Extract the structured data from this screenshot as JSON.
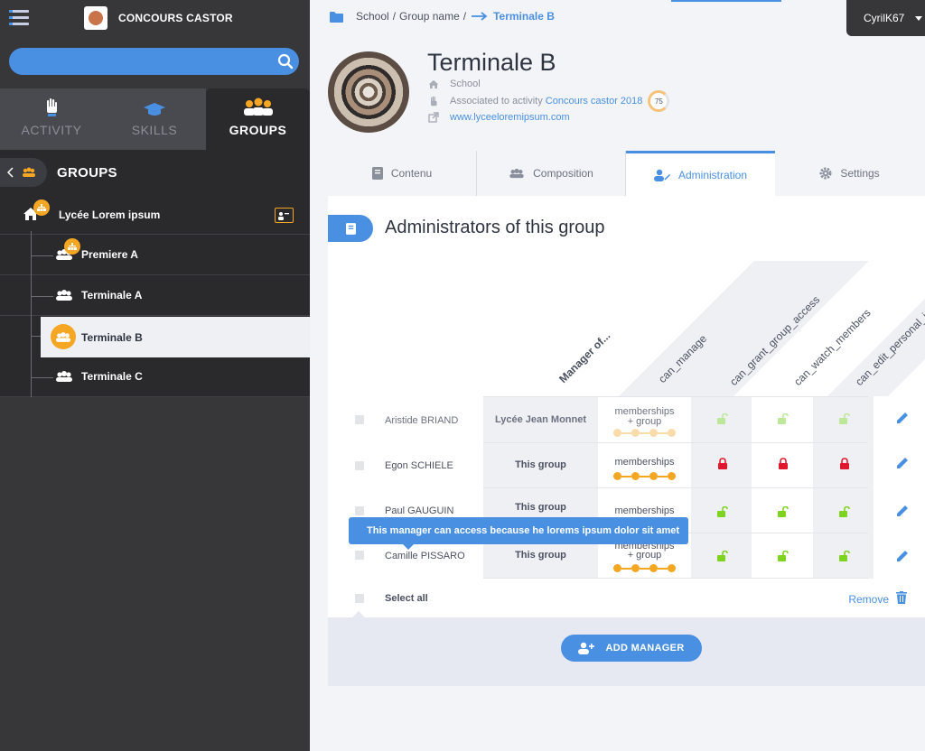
{
  "app": {
    "title": "CONCOURS CASTOR"
  },
  "search": {
    "placeholder": ""
  },
  "tabs": [
    {
      "label": "ACTIVITY",
      "icon": "hand-icon"
    },
    {
      "label": "SKILLS",
      "icon": "graduation-cap-icon"
    },
    {
      "label": "GROUPS",
      "icon": "group-icon"
    }
  ],
  "groups_panel": {
    "title": "GROUPS"
  },
  "tree": {
    "root": "Lycée Lorem ipsum",
    "children": [
      "Premiere A",
      "Terminale A",
      "Terminale B",
      "Terminale C"
    ]
  },
  "breadcrumb": {
    "part1": "School",
    "sep": "/",
    "part2": "Group name",
    "sep2": "/",
    "current": "Terminale B"
  },
  "user": {
    "name": "CyrilK67"
  },
  "group": {
    "name": "Terminale B",
    "type": "School",
    "activity_prefix": "Associated to activity",
    "activity_link": "Concours castor 2018",
    "score": "75",
    "website": "www.lyceeloremipsum.com"
  },
  "content_tabs": [
    "Contenu",
    "Composition",
    "Administration",
    "Settings"
  ],
  "section": {
    "title": "Administrators of this group"
  },
  "columns": [
    "Manager of...",
    "can_manage",
    "can_grant_group_access",
    "can_watch_members",
    "can_edit_personal_i"
  ],
  "managers": [
    {
      "name": "Aristide BRIAND",
      "manager_of": "Lycée Jean Monnet",
      "mem1": "memberships",
      "mem2": "+ group",
      "dots": 4,
      "locks": [
        "open",
        "open",
        "open"
      ],
      "faded": true
    },
    {
      "name": "Egon SCHIELE",
      "manager_of": "This group",
      "mem1": "memberships",
      "mem2": "",
      "dots": 4,
      "locks": [
        "closed",
        "closed",
        "closed"
      ],
      "faded": false
    },
    {
      "name": "Paul GAUGUIN",
      "manager_of": "This group",
      "mem1": "memberships",
      "mem2": "",
      "dots": 0,
      "locks": [
        "open",
        "open",
        "open"
      ],
      "faded": false
    },
    {
      "name": "Camille PISSARO",
      "manager_of": "This group",
      "mem1": "memberships",
      "mem2": "+ group",
      "dots": 4,
      "locks": [
        "open",
        "open",
        "open"
      ],
      "faded": false
    }
  ],
  "tooltip": "This manager can access because he lorems ipsum dolor sit amet",
  "footer": {
    "select_all": "Select all",
    "remove": "Remove",
    "add_manager": "ADD MANAGER"
  },
  "colors": {
    "accent": "#4a90e2",
    "orange": "#f5a623",
    "lock_open": "#7ed321",
    "lock_closed": "#e0182d",
    "sidebar": "#37373a"
  }
}
